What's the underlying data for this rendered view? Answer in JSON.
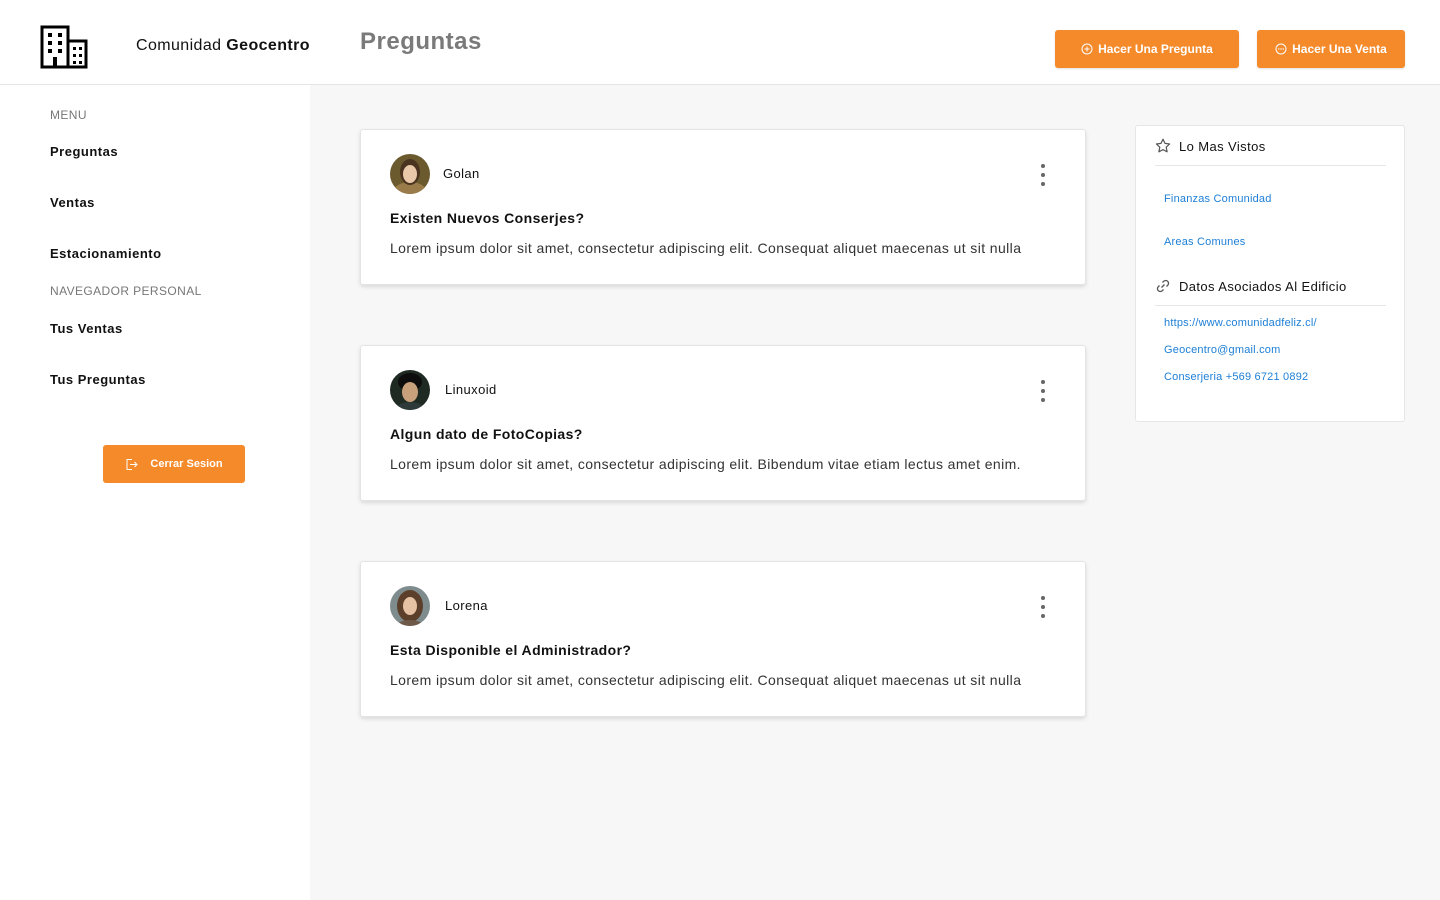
{
  "header": {
    "brand_prefix": "Comunidad",
    "brand_name": "Geocentro",
    "page_title": "Preguntas",
    "ask_button": "Hacer Una Pregunta",
    "sell_button": "Hacer Una Venta"
  },
  "sidebar": {
    "menu_label": "MENU",
    "items": [
      "Preguntas",
      "Ventas",
      "Estacionamiento"
    ],
    "personal_label": "NAVEGADOR PERSONAL",
    "personal_items": [
      "Tus Ventas",
      "Tus Preguntas"
    ],
    "logout": "Cerrar Sesion"
  },
  "questions": [
    {
      "author": "Golan",
      "title": "Existen Nuevos Conserjes?",
      "body": "Lorem ipsum dolor sit amet, consectetur adipiscing elit. Consequat aliquet maecenas ut sit nulla"
    },
    {
      "author": "Linuxoid",
      "title": "Algun dato de FotoCopias?",
      "body": "Lorem ipsum dolor sit amet, consectetur adipiscing elit. Bibendum vitae etiam lectus amet enim."
    },
    {
      "author": "Lorena",
      "title": "Esta Disponible el Administrador?",
      "body": "Lorem ipsum dolor sit amet, consectetur adipiscing elit. Consequat aliquet maecenas ut sit nulla"
    }
  ],
  "panel": {
    "most_viewed_title": "Lo Mas Vistos",
    "most_viewed_links": [
      "Finanzas Comunidad",
      "Areas Comunes"
    ],
    "building_title": "Datos Asociados Al Edificio",
    "building_links": [
      "https://www.comunidadfeliz.cl/",
      "Geocentro@gmail.com",
      "Conserjeria +569 6721 0892"
    ]
  },
  "icons": {
    "logo": "building-icon",
    "ask": "plus-circle-icon",
    "sell": "dots-circle-icon",
    "logout": "logout-icon",
    "most_viewed": "star-icon",
    "building": "link-icon",
    "more": "kebab-icon"
  },
  "colors": {
    "accent": "#f58a2b",
    "link": "#1e7fd6",
    "title_gray": "#7a7a7a",
    "main_bg": "#f7f7f7"
  }
}
